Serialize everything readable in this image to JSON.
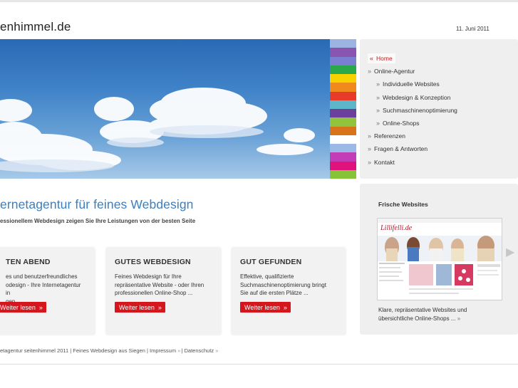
{
  "header": {
    "site_title": "enhimmel.de",
    "date": "11. Juni 2011"
  },
  "colors": {
    "accent_red": "#d5171d",
    "headline_blue": "#3a7fc0",
    "stripes": [
      "#9db4e3",
      "#8a55b0",
      "#7a7fd1",
      "#2aa84a",
      "#f5d200",
      "#f08a1c",
      "#e83b2a",
      "#5eb7c8",
      "#6d3f9c",
      "#8fc43c",
      "#d8731b",
      "#ffffff",
      "#9cb8e6",
      "#c23db6",
      "#e0127e",
      "#86c336"
    ]
  },
  "nav": {
    "items": [
      {
        "label": "Home",
        "level": 1,
        "active": true
      },
      {
        "label": "Online-Agentur",
        "level": 1,
        "active": false
      },
      {
        "label": "Individuelle Websites",
        "level": 2,
        "active": false
      },
      {
        "label": "Webdesign & Konzeption",
        "level": 2,
        "active": false
      },
      {
        "label": "Suchmaschinenoptimierung",
        "level": 2,
        "active": false
      },
      {
        "label": "Online-Shops",
        "level": 2,
        "active": false
      },
      {
        "label": "Referenzen",
        "level": 1,
        "active": false
      },
      {
        "label": "Fragen & Antworten",
        "level": 1,
        "active": false
      },
      {
        "label": "Kontakt",
        "level": 1,
        "active": false
      }
    ]
  },
  "intro": {
    "headline": "ernetagentur für feines Webdesign",
    "subline": "essionellem Webdesign zeigen Sie Ihre Leistungen von der besten Seite"
  },
  "cards": [
    {
      "title": "TEN ABEND",
      "lines": [
        "es und benutzerfreundliches",
        "odesign - Ihre Internetagentur in",
        "gen ..."
      ],
      "button": "Weiter lesen"
    },
    {
      "title": "GUTES WEBDESIGN",
      "lines": [
        "Feines Webdesign für Ihre",
        "repräsentative Website - oder Ihren",
        "professionellen Online-Shop ..."
      ],
      "button": "Weiter lesen"
    },
    {
      "title": "GUT GEFUNDEN",
      "lines": [
        "Effektive, qualifizierte",
        "Suchmaschinenoptimierung bringt",
        "Sie auf die ersten Plätze ..."
      ],
      "button": "Weiter lesen"
    }
  ],
  "panel": {
    "title": "Frische Websites",
    "thumb_logo": "Lillifelli.de",
    "description_line1": "Klare, repräsentative Websites und",
    "description_line2": "übersichtliche Online-Shops ..."
  },
  "footer": {
    "text": "etagentur seitenhimmel 2011 | Feines Webdesign aus Siegen | Impressum",
    "datenschutz": "Datenschutz"
  },
  "icons": {
    "nav_bullet": "double-chevron-right-icon",
    "nav_active": "double-chevron-left-icon",
    "button_chevron": "double-chevron-right-icon",
    "slider_next": "triangle-right-icon"
  }
}
